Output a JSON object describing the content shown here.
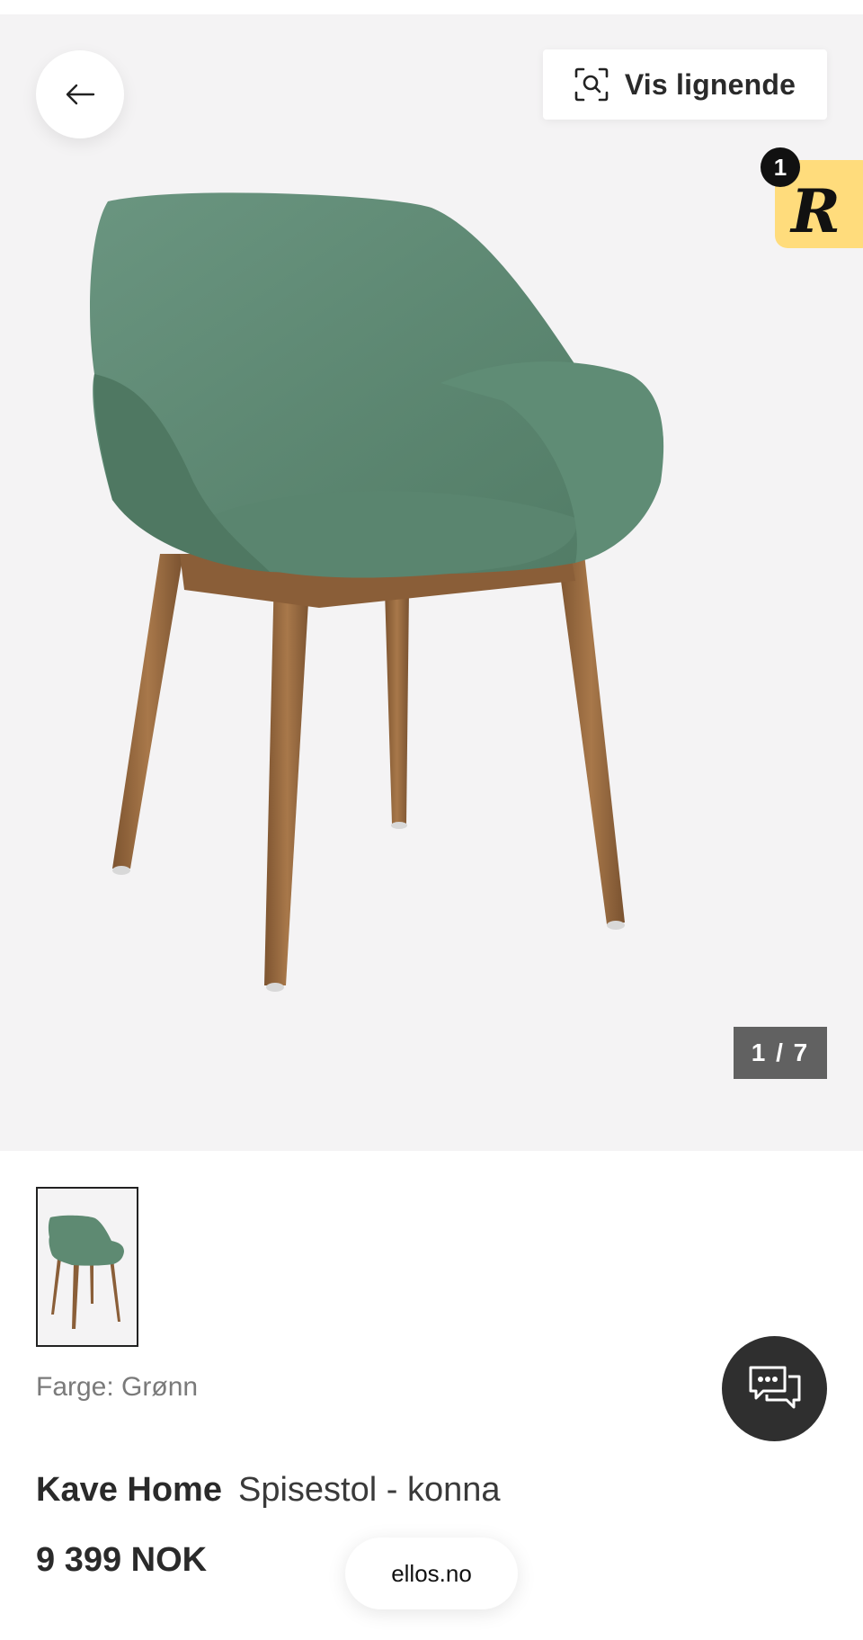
{
  "header": {
    "back_icon": "arrow-left-icon",
    "similar": {
      "label": "Vis lignende",
      "icon": "visual-search-icon"
    }
  },
  "badge": {
    "count": "1",
    "letter": "R",
    "color": "#ffdc7c"
  },
  "gallery": {
    "counter": "1 / 7",
    "thumbnails": [
      "chair-thumbnail"
    ]
  },
  "product": {
    "color_label": "Farge: Grønn",
    "brand": "Kave Home",
    "name": "Spisestol - konna",
    "price": "9 399 NOK"
  },
  "chat": {
    "icon": "chat-bubbles-icon"
  },
  "footer": {
    "domain": "ellos.no"
  },
  "colors": {
    "chair_fabric": "#5e8a72",
    "chair_legs": "#9a6a40",
    "hero_bg": "#f4f3f4"
  }
}
